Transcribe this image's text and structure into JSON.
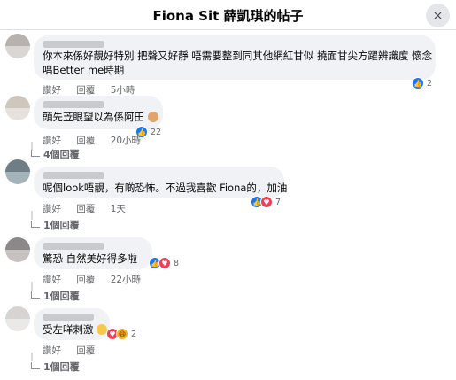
{
  "header": {
    "title": "Fiona Sit 薛凱琪的帖子",
    "close_icon": "×"
  },
  "comments": [
    {
      "text_lines": [
        "你本來係好靚好特別 把聲又好靜 唔需要整到同其他網紅甘似 撓面甘尖方躍辨識度 懷念",
        "唱Better me時期"
      ],
      "like": "讚好",
      "reply": "回覆",
      "time": "5小時",
      "reaction_count": "2",
      "reactions": [
        "like"
      ]
    },
    {
      "text_lines": [
        "頭先苙眼望以為係阿田"
      ],
      "like": "讚好",
      "reply": "回覆",
      "time": "20小時",
      "reaction_count": "22",
      "reactions": [
        "like"
      ],
      "replies_label": "4個回覆"
    },
    {
      "text_lines": [
        "呢個look唔靚，有啲恐怖。不過我喜歡 Fiona的，加油"
      ],
      "like": "讚好",
      "reply": "回覆",
      "time": "1天",
      "reaction_count": "7",
      "reactions": [
        "like",
        "love"
      ],
      "replies_label": "1個回覆"
    },
    {
      "text_lines": [
        "驚恐 自然美好得多啦"
      ],
      "like": "讚好",
      "reply": "回覆",
      "time": "22小時",
      "reaction_count": "8",
      "reactions": [
        "like",
        "love"
      ],
      "replies_label": "1個回覆"
    },
    {
      "text_lines": [
        "受左咩刺激"
      ],
      "like": "讚好",
      "reply": "回覆",
      "time": "",
      "reaction_count": "2",
      "reactions": [
        "love",
        "haha"
      ],
      "replies_label": "1個回覆"
    }
  ],
  "icons": {
    "close": "close-icon",
    "like": "thumbs-up-icon",
    "love": "heart-icon",
    "haha": "laugh-icon",
    "reply_arrow": "reply-arrow-icon"
  },
  "colors": {
    "like": "#1877f2",
    "love": "#f33e58",
    "haha": "#f7b125",
    "bubble": "#f0f2f5",
    "meta": "#65676b"
  }
}
